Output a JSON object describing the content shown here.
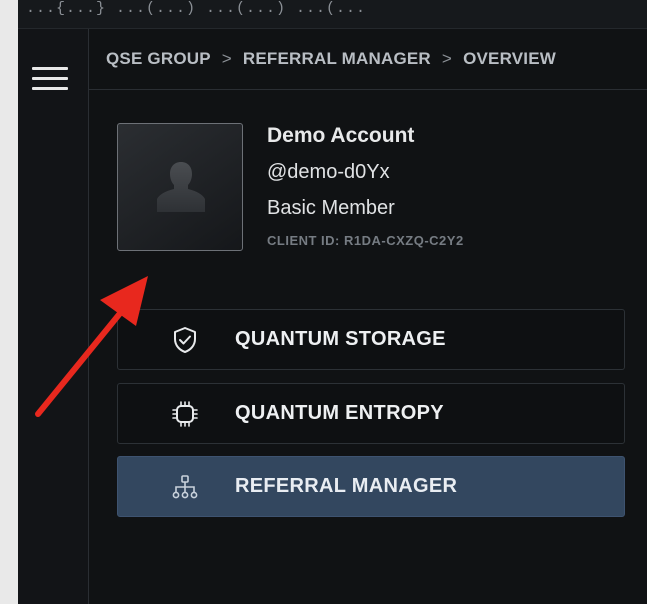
{
  "topbar": {
    "text": "...{...}  ...(...)  ...(...)  ...(..."
  },
  "breadcrumb": {
    "items": [
      "QSE GROUP",
      "REFERRAL MANAGER",
      "OVERVIEW"
    ],
    "separator": ">"
  },
  "profile": {
    "name": "Demo Account",
    "handle": "@demo-d0Yx",
    "tier": "Basic Member",
    "client_id": "CLIENT ID: R1DA-CXZQ-C2Y2"
  },
  "menu": {
    "items": [
      {
        "label": "QUANTUM STORAGE",
        "icon": "shield-check-icon",
        "active": false
      },
      {
        "label": "QUANTUM ENTROPY",
        "icon": "chip-icon",
        "active": false
      },
      {
        "label": "REFERRAL MANAGER",
        "icon": "network-icon",
        "active": true
      }
    ]
  },
  "colors": {
    "background": "#0f1113",
    "active_item": "#33475f",
    "annotation_arrow": "#e8281e",
    "text_primary": "#e8e9ea",
    "text_muted": "#767c83"
  }
}
